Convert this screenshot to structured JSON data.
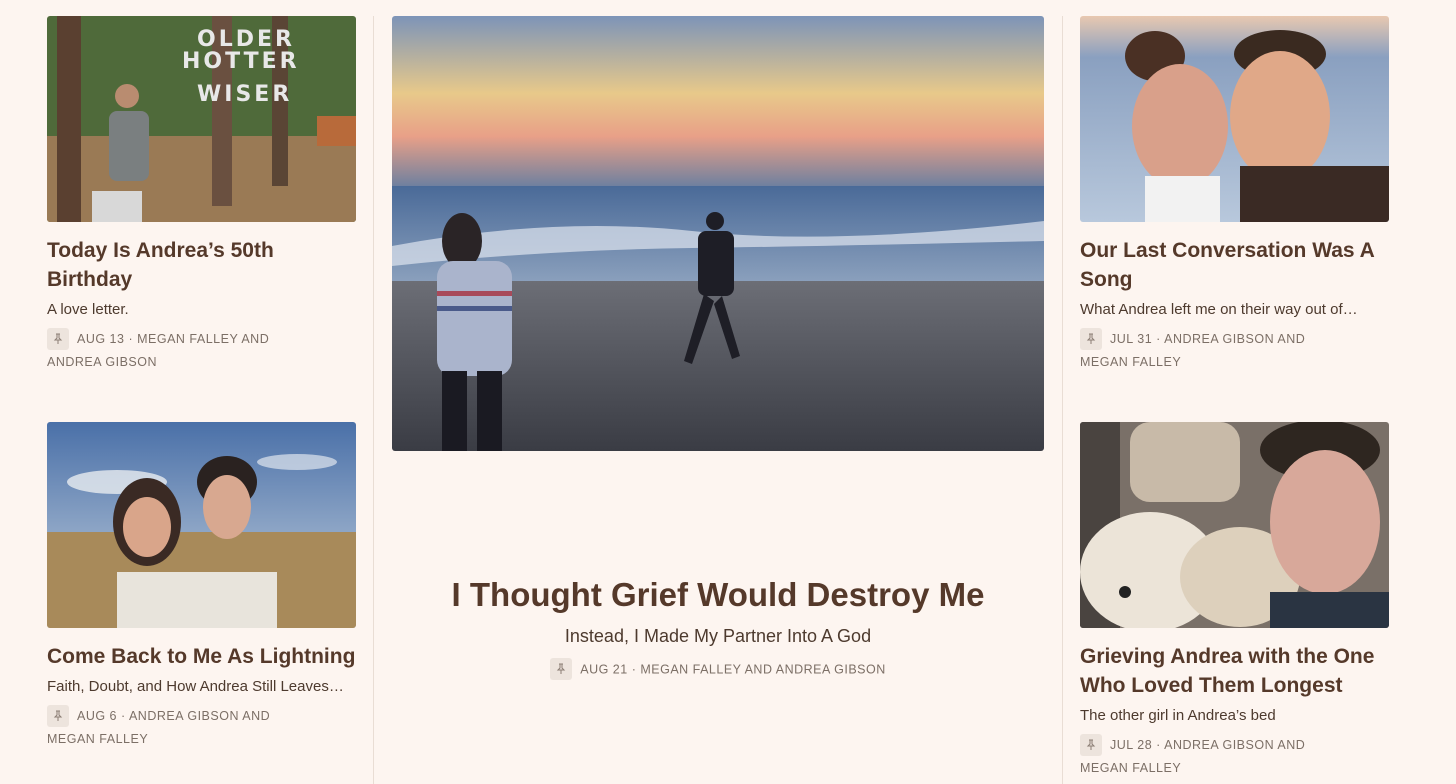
{
  "posts": {
    "top_left": {
      "title": "Today Is Andrea’s 50th Birthday",
      "subtitle": "A love letter.",
      "date": "AUG 13",
      "authors_line1": "MEGAN FALLEY AND",
      "authors_line2": "ANDREA GIBSON",
      "image_sign_text": [
        "OLDER",
        "HOTTER",
        "WISER"
      ]
    },
    "bottom_left": {
      "title": "Come Back to Me As Lightning",
      "subtitle": "Faith, Doubt, and How Andrea Still Leaves…",
      "date": "AUG 6",
      "authors_line1": "ANDREA GIBSON AND",
      "authors_line2": "MEGAN FALLEY"
    },
    "featured": {
      "title": "I Thought Grief Would Destroy Me",
      "subtitle": "Instead, I Made My Partner Into A God",
      "date": "AUG 21",
      "authors": "MEGAN FALLEY AND ANDREA GIBSON"
    },
    "top_right": {
      "title": "Our Last Conversation Was A Song",
      "subtitle": "What Andrea left me on their way out of…",
      "date": "JUL 31",
      "authors_line1": "ANDREA GIBSON AND",
      "authors_line2": "MEGAN FALLEY"
    },
    "bottom_right": {
      "title": "Grieving Andrea with the One Who Loved Them Longest",
      "subtitle": "The other girl in Andrea’s bed",
      "date": "JUL 28",
      "authors_line1": "ANDREA GIBSON AND",
      "authors_line2": "MEGAN FALLEY"
    }
  },
  "separator": "·",
  "icons": {
    "pin": "pin-icon"
  },
  "colors": {
    "background": "#fdf5f0",
    "title": "#55392a",
    "meta": "#7c6f66",
    "divider": "#e9ddd4"
  }
}
